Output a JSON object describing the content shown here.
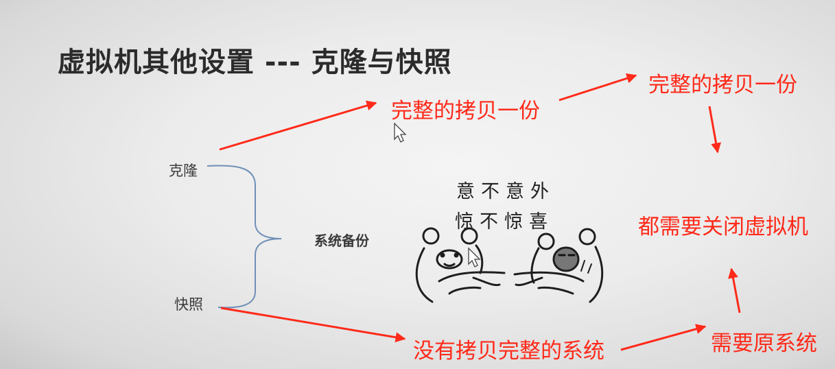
{
  "slide": {
    "title": "虚拟机其他设置 --- 克隆与快照",
    "left_labels": {
      "clone": "克隆",
      "snapshot": "快照"
    },
    "center_label": "系统备份",
    "meme_lines": [
      "意不意外",
      "惊不惊喜"
    ]
  },
  "annotations": {
    "clone_full_copy": "完整的拷贝一份",
    "clone_full_copy_2": "完整的拷贝一份",
    "shutdown_note": "都需要关闭虚拟机",
    "snapshot_no_copy": "没有拷贝完整的系统",
    "needs_original": "需要原系统"
  },
  "colors": {
    "annotation": "#ff2a1a",
    "brace": "#6f8fb6",
    "text": "#3a3a3a"
  },
  "icons": [
    "mouse-cursor-icon",
    "mouse-cursor-icon",
    "bear-meme-icon"
  ]
}
